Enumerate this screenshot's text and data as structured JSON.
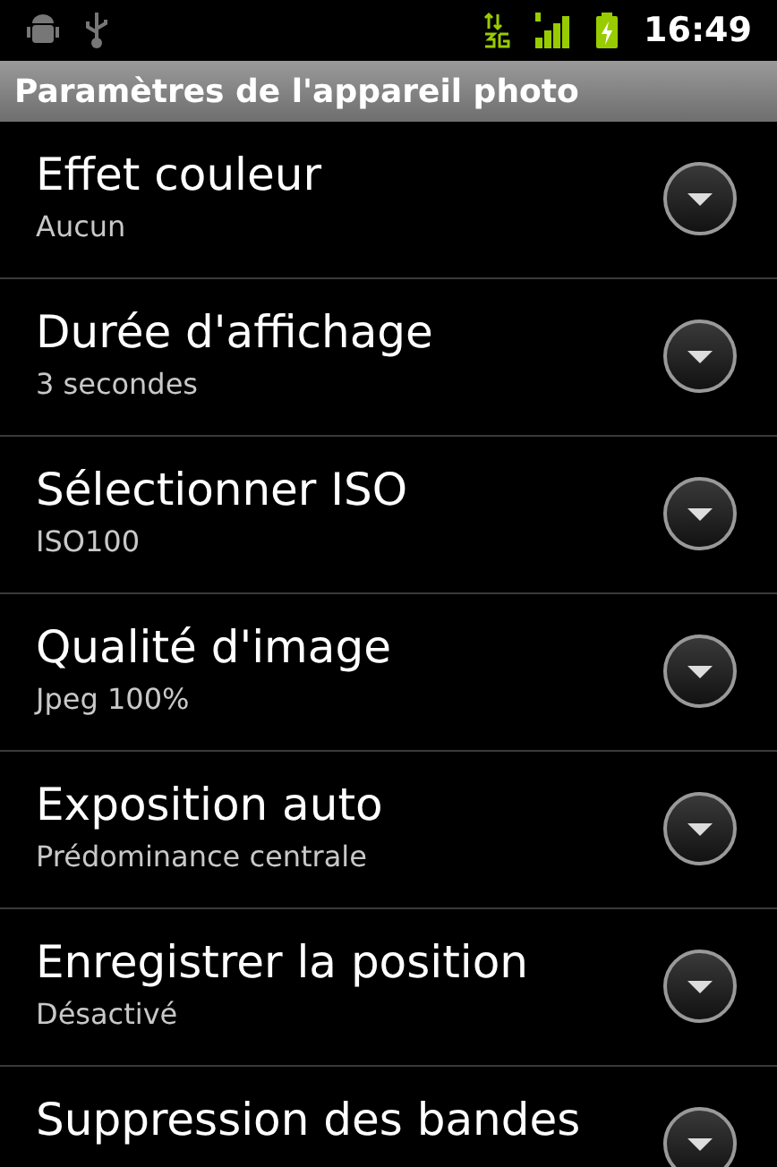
{
  "status_bar": {
    "time": "16:49"
  },
  "title": "Paramètres de l'appareil photo",
  "settings": [
    {
      "title": "Effet couleur",
      "value": "Aucun"
    },
    {
      "title": "Durée d'affichage",
      "value": "3 secondes"
    },
    {
      "title": "Sélectionner ISO",
      "value": "ISO100"
    },
    {
      "title": "Qualité d'image",
      "value": "Jpeg 100%"
    },
    {
      "title": "Exposition auto",
      "value": "Prédominance centrale"
    },
    {
      "title": "Enregistrer la position",
      "value": "Désactivé"
    },
    {
      "title": "Suppression des bandes"
    }
  ]
}
